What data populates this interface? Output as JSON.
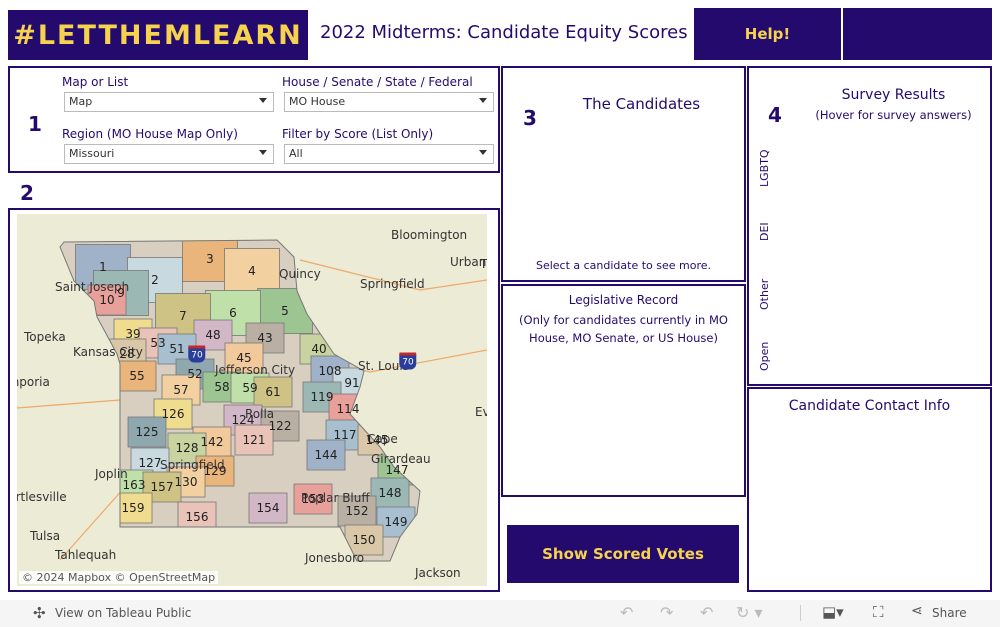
{
  "header": {
    "logo": "#LETTHEMLEARN",
    "title": "2022 Midterms: Candidate Equity Scores",
    "help": "Help!"
  },
  "filters": {
    "step": "1",
    "map_or_list": {
      "label": "Map or List",
      "value": "Map"
    },
    "chamber": {
      "label": "House / Senate / State / Federal",
      "value": "MO House"
    },
    "region": {
      "label": "Region (MO House Map Only)",
      "value": "Missouri"
    },
    "score": {
      "label": "Filter by Score (List Only)",
      "value": "All"
    }
  },
  "map": {
    "step": "2",
    "attribution": "© 2024 Mapbox  © OpenStreetMap",
    "cities": [
      "Bloomington",
      "Urbana",
      "Quincy",
      "Springfield",
      "Saint Joseph",
      "Topeka",
      "Kansas City",
      "Jefferson City",
      "St. Louis",
      "Emporia",
      "Rolla",
      "Cape",
      "Girardeau",
      "Springfield",
      "Joplin",
      "Poplar Bluff",
      "Bartlesville",
      "Tulsa",
      "Tahlequah",
      "Jonesboro",
      "Jackson",
      "Ev",
      "T"
    ],
    "districts": [
      "1",
      "2",
      "3",
      "4",
      "5",
      "6",
      "7",
      "9",
      "10",
      "39",
      "48",
      "43",
      "53",
      "51",
      "28",
      "52",
      "45",
      "40",
      "108",
      "91",
      "55",
      "57",
      "58",
      "59",
      "61",
      "119",
      "114",
      "126",
      "124",
      "122",
      "121",
      "117",
      "145",
      "125",
      "142",
      "128",
      "144",
      "127",
      "129",
      "130",
      "147",
      "163",
      "157",
      "148",
      "153",
      "159",
      "154",
      "152",
      "156",
      "149",
      "150"
    ],
    "highway": "70"
  },
  "candidates": {
    "step": "3",
    "title": "The Candidates",
    "hint": "Select a candidate to see more."
  },
  "record": {
    "title": "Legislative Record",
    "subtitle": "(Only for candidates currently in MO House, MO Senate, or US House)"
  },
  "survey": {
    "step": "4",
    "title": "Survey Results",
    "subtitle": "(Hover for survey answers)",
    "categories": [
      "LGBTQ",
      "DEI",
      "Other",
      "Open"
    ]
  },
  "contact": {
    "title": "Candidate Contact Info"
  },
  "votes_button": "Show Scored Votes",
  "footer": {
    "view": "View on Tableau Public",
    "share": "Share"
  },
  "colors": {
    "primary": "#250a6e",
    "accent": "#f5d34e"
  }
}
